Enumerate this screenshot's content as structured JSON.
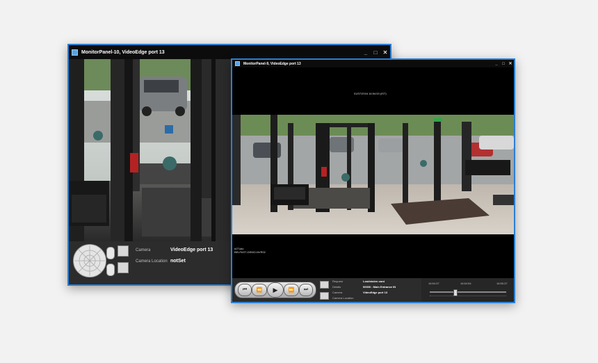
{
  "windows": {
    "back": {
      "title": "MonitorPanel-10, VideoEdge port 13",
      "camera_label": "Camera",
      "camera_value": "VideoEdge port 13",
      "location_label": "Camera Location",
      "location_value": "notSet"
    },
    "front": {
      "title": "MonitorPanel-9, VideoEdge port 13",
      "timestamp": "01/07/2016 16:54:53 (IST)",
      "overlay_line1": "#2Tudo",
      "overlay_line2": "BELFAST-DEMO-NVR02",
      "info": {
        "request_label": "Request",
        "request_value": "Lost/stolen card",
        "details_label": "Details",
        "details_value": "00000 : Main Entrance IN",
        "camera_label": "Camera",
        "camera_value": "VideoEdge port 13",
        "location_label": "Camera Location"
      },
      "timeline": {
        "start": "16:54:37",
        "mid": "16:54:54",
        "end": "16:55:37",
        "position": 0.32
      }
    }
  },
  "window_controls": {
    "minimize": "_",
    "maximize": "□",
    "close": "✕"
  },
  "colors": {
    "window_border": "#2a7fd4",
    "titlebar": "#0c0c0c",
    "panel": "#2c2c2c",
    "page": "#f2f2f2"
  }
}
